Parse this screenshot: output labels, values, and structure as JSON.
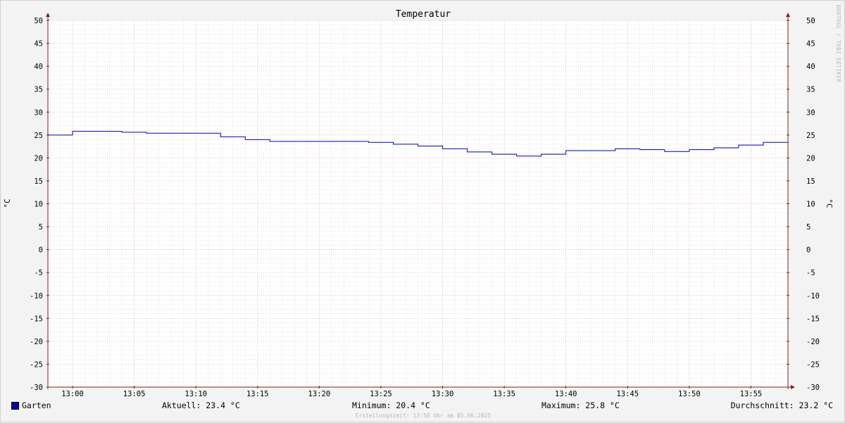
{
  "chart_data": {
    "type": "line",
    "title": "Temperatur",
    "ylabel_left": "°C",
    "ylabel_right": "°C",
    "ylim": [
      -30,
      50
    ],
    "y_ticks": [
      50,
      45,
      40,
      35,
      30,
      25,
      20,
      15,
      10,
      5,
      0,
      -5,
      -10,
      -15,
      -20,
      -25,
      -30
    ],
    "xlim": [
      "12:58",
      "13:58"
    ],
    "x_ticks": [
      "13:00",
      "13:05",
      "13:10",
      "13:15",
      "13:20",
      "13:25",
      "13:30",
      "13:35",
      "13:40",
      "13:45",
      "13:50",
      "13:55"
    ],
    "grid": true,
    "step": true,
    "series": [
      {
        "name": "Garten",
        "color": "#0000aa",
        "x": [
          "12:58",
          "13:00",
          "13:02",
          "13:04",
          "13:06",
          "13:08",
          "13:10",
          "13:12",
          "13:14",
          "13:16",
          "13:18",
          "13:20",
          "13:22",
          "13:24",
          "13:26",
          "13:28",
          "13:30",
          "13:32",
          "13:34",
          "13:36",
          "13:38",
          "13:40",
          "13:42",
          "13:44",
          "13:46",
          "13:48",
          "13:50",
          "13:52",
          "13:54",
          "13:56",
          "13:58"
        ],
        "y": [
          25.0,
          25.8,
          25.8,
          25.6,
          25.4,
          25.4,
          25.4,
          24.6,
          24.0,
          23.6,
          23.6,
          23.6,
          23.6,
          23.4,
          23.0,
          22.6,
          22.0,
          21.3,
          20.8,
          20.4,
          20.8,
          21.6,
          21.6,
          22.0,
          21.8,
          21.4,
          21.8,
          22.2,
          22.8,
          23.4,
          23.4
        ]
      }
    ]
  },
  "legend": {
    "series_name": "Garten",
    "swatch_color": "#0000aa"
  },
  "stats": {
    "current": "Aktuell: 23.4 °C",
    "minimum": "Minimum: 20.4 °C",
    "maximum": "Maximum: 25.8 °C",
    "average": "Durchschnitt: 23.2 °C"
  },
  "footer": {
    "timestamp": "Erstellungszeit: 13:58 Uhr am 05.06.2025"
  },
  "watermark": "RRDTOOL / TOBI OETIKER",
  "colors": {
    "background": "#f3f3f3",
    "plot_background": "#ffffff",
    "major_grid": "#e8a0a0",
    "minor_grid": "#d0d0d0",
    "axis": "#802020",
    "line": "#0000aa"
  }
}
